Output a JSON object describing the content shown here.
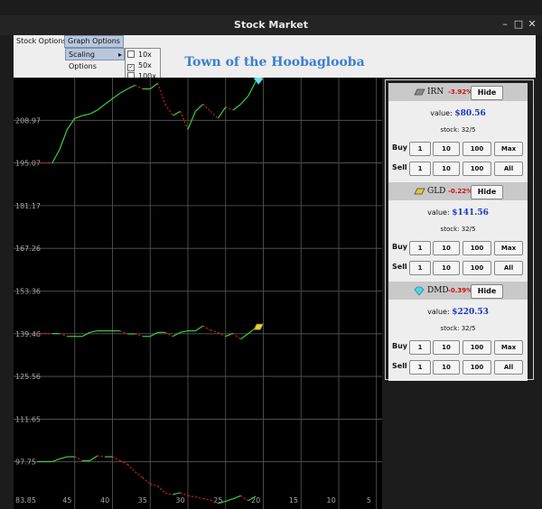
{
  "window": {
    "title": "Stock Market",
    "minimize_glyph": "–",
    "maximize_glyph": "□",
    "close_glyph": "✕"
  },
  "menubar": {
    "stock_options": "Stock Options",
    "graph_options": "Graph Options"
  },
  "submenu": {
    "scaling_label": "Scaling Options",
    "arrow": "▸"
  },
  "scaling_popup": {
    "items": [
      {
        "label": "10x",
        "checked": false,
        "mark": ""
      },
      {
        "label": "50x",
        "checked": true,
        "mark": "✓"
      },
      {
        "label": "100x",
        "checked": false,
        "mark": ""
      }
    ]
  },
  "header": {
    "town_name": "Town of the Hoobaglooba"
  },
  "stocks": [
    {
      "name": "IRN",
      "change": "-3.92%",
      "value_label": "value:",
      "value": "$80.56",
      "stock_text": "stock: 32/5",
      "hide_label": "Hide",
      "icon": "iron-ingot-icon",
      "icon_color": "#8a8a8a"
    },
    {
      "name": "GLD",
      "change": "-0.22%",
      "value_label": "value:",
      "value": "$141.56",
      "stock_text": "stock: 32/5",
      "hide_label": "Hide",
      "icon": "gold-ingot-icon",
      "icon_color": "#e0c83a"
    },
    {
      "name": "DMD",
      "change": "-0.39%",
      "value_label": "value:",
      "value": "$220.53",
      "stock_text": "stock: 32/5",
      "hide_label": "Hide",
      "icon": "diamond-icon",
      "icon_color": "#4fd6e6"
    }
  ],
  "trade": {
    "buy_label": "Buy",
    "sell_label": "Sell",
    "buy_buttons": [
      "1",
      "10",
      "100",
      "Max"
    ],
    "sell_buttons": [
      "1",
      "10",
      "100",
      "All"
    ]
  },
  "chart_data": {
    "type": "line",
    "y_ticks": [
      "208.97",
      "195.07",
      "181.17",
      "167.26",
      "153.36",
      "139.46",
      "125.56",
      "111.65",
      "97.75",
      "83.85"
    ],
    "x_ticks": [
      "45",
      "40",
      "35",
      "30",
      "25",
      "20",
      "15",
      "10",
      "5"
    ],
    "ylim": [
      83.85,
      222.87
    ],
    "xlim": [
      49,
      0
    ],
    "rise_color": "#3ccf3c",
    "fall_color": "#d42020",
    "series": [
      {
        "icon": "diamond-icon",
        "x": [
          49,
          47,
          46,
          45,
          44,
          43,
          42,
          41,
          40,
          39,
          38,
          37,
          36,
          35,
          34,
          33,
          32,
          31,
          30,
          29,
          28,
          27,
          26,
          25,
          24,
          23,
          22,
          21,
          20
        ],
        "y": [
          195.1,
          195.0,
          199.5,
          206.0,
          209.6,
          210.5,
          211.0,
          212.3,
          214.2,
          216.0,
          217.8,
          219.2,
          220.4,
          219.2,
          219.2,
          221.0,
          214.2,
          210.5,
          211.9,
          206.0,
          211.9,
          214.2,
          211.9,
          209.6,
          213.3,
          212.3,
          214.2,
          216.9,
          221.6
        ]
      },
      {
        "icon": "gold-ingot-icon",
        "x": [
          49,
          47,
          46,
          45,
          44,
          43,
          42,
          41,
          40,
          39,
          38,
          37,
          36,
          35,
          34,
          33,
          32,
          31,
          30,
          29,
          28,
          27,
          26,
          25,
          24,
          23,
          22,
          21,
          20
        ],
        "y": [
          139.6,
          139.5,
          139.5,
          138.6,
          138.6,
          138.6,
          139.9,
          140.4,
          140.4,
          140.4,
          140.4,
          139.4,
          139.4,
          138.6,
          138.6,
          139.9,
          139.9,
          138.6,
          139.9,
          140.4,
          140.4,
          142.0,
          140.6,
          139.8,
          138.6,
          139.6,
          137.7,
          139.5,
          141.4
        ]
      },
      {
        "icon": "iron-ingot-icon",
        "x": [
          49,
          47,
          46,
          45,
          44,
          43,
          42,
          41,
          40,
          39,
          38,
          37,
          36,
          35,
          34,
          33,
          32,
          31,
          30,
          29,
          28,
          27,
          26,
          25,
          24,
          23,
          22,
          21,
          20
        ],
        "y": [
          97.8,
          97.8,
          98.7,
          99.4,
          99.4,
          98.1,
          98.1,
          99.7,
          99.4,
          99.4,
          98.1,
          96.9,
          94.5,
          92.6,
          90.5,
          89.9,
          87.5,
          87.1,
          87.7,
          86.7,
          86.3,
          85.7,
          85.3,
          84.2,
          84.9,
          85.7,
          86.7,
          85.1,
          86.5
        ]
      }
    ]
  }
}
